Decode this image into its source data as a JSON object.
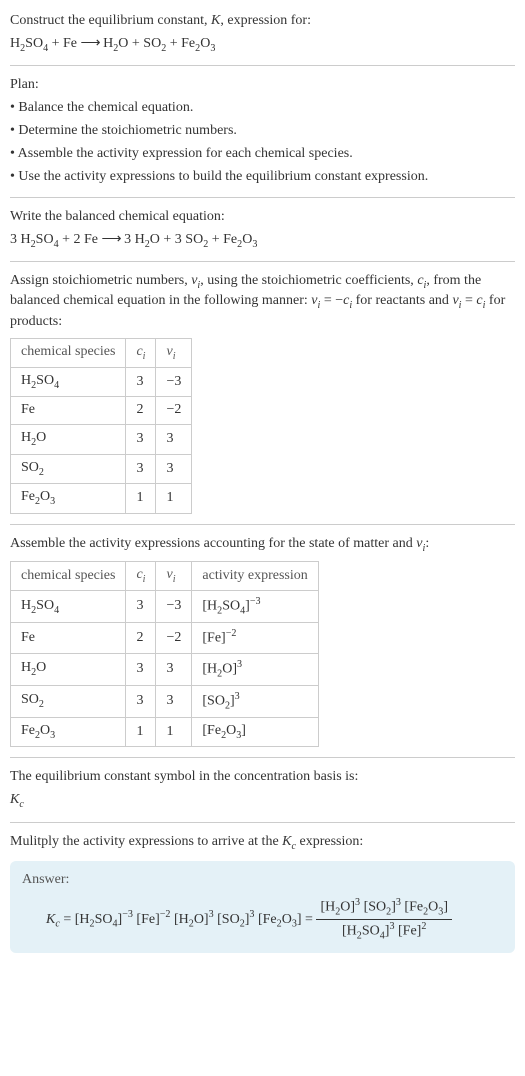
{
  "intro": {
    "line1_a": "Construct the equilibrium constant, ",
    "K": "K",
    "line1_b": ", expression for:",
    "eq_lhs1": "H",
    "eq_lhs2": "2",
    "eq_lhs3": "SO",
    "eq_lhs4": "4",
    "plus1": " + Fe ",
    "arrow": "⟶",
    "eq_rhs1": " H",
    "eq_rhs2": "2",
    "eq_rhs3": "O + SO",
    "eq_rhs4": "2",
    "eq_rhs5": " + Fe",
    "eq_rhs6": "2",
    "eq_rhs7": "O",
    "eq_rhs8": "3"
  },
  "plan": {
    "title": "Plan:",
    "b1": "• Balance the chemical equation.",
    "b2": "• Determine the stoichiometric numbers.",
    "b3": "• Assemble the activity expression for each chemical species.",
    "b4": "• Use the activity expressions to build the equilibrium constant expression."
  },
  "balanced": {
    "title": "Write the balanced chemical equation:",
    "c1": "3 H",
    "c2": "2",
    "c3": "SO",
    "c4": "4",
    "c5": " + 2 Fe ",
    "arrow": "⟶",
    "c6": " 3 H",
    "c7": "2",
    "c8": "O + 3 SO",
    "c9": "2",
    "c10": " + Fe",
    "c11": "2",
    "c12": "O",
    "c13": "3"
  },
  "assign": {
    "t1": "Assign stoichiometric numbers, ",
    "nu": "ν",
    "i": "i",
    "t2": ", using the stoichiometric coefficients, ",
    "c": "c",
    "t3": ", from the balanced chemical equation in the following manner: ",
    "eq1a": " = −",
    "eq1b": " for reactants and ",
    "eq2a": " = ",
    "eq2b": " for products:"
  },
  "table1": {
    "h1": "chemical species",
    "h2": "c",
    "h2s": "i",
    "h3": "ν",
    "h3s": "i",
    "r1": {
      "s1": "H",
      "s2": "2",
      "s3": "SO",
      "s4": "4",
      "c": "3",
      "v": "−3"
    },
    "r2": {
      "s1": "Fe",
      "c": "2",
      "v": "−2"
    },
    "r3": {
      "s1": "H",
      "s2": "2",
      "s3": "O",
      "c": "3",
      "v": "3"
    },
    "r4": {
      "s1": "SO",
      "s2": "2",
      "c": "3",
      "v": "3"
    },
    "r5": {
      "s1": "Fe",
      "s2": "2",
      "s3": "O",
      "s4": "3",
      "c": "1",
      "v": "1"
    }
  },
  "assemble": {
    "t1": "Assemble the activity expressions accounting for the state of matter and ",
    "nu": "ν",
    "i": "i",
    "t2": ":"
  },
  "table2": {
    "h1": "chemical species",
    "h2": "c",
    "h2s": "i",
    "h3": "ν",
    "h3s": "i",
    "h4": "activity expression",
    "r1": {
      "s1": "H",
      "s2": "2",
      "s3": "SO",
      "s4": "4",
      "c": "3",
      "v": "−3",
      "a1": "[H",
      "a2": "2",
      "a3": "SO",
      "a4": "4",
      "a5": "]",
      "exp": "−3"
    },
    "r2": {
      "s1": "Fe",
      "c": "2",
      "v": "−2",
      "a1": "[Fe]",
      "exp": "−2"
    },
    "r3": {
      "s1": "H",
      "s2": "2",
      "s3": "O",
      "c": "3",
      "v": "3",
      "a1": "[H",
      "a2": "2",
      "a3": "O]",
      "exp": "3"
    },
    "r4": {
      "s1": "SO",
      "s2": "2",
      "c": "3",
      "v": "3",
      "a1": "[SO",
      "a2": "2",
      "a3": "]",
      "exp": "3"
    },
    "r5": {
      "s1": "Fe",
      "s2": "2",
      "s3": "O",
      "s4": "3",
      "c": "1",
      "v": "1",
      "a1": "[Fe",
      "a2": "2",
      "a3": "O",
      "a4": "3",
      "a5": "]"
    }
  },
  "symbol": {
    "t1": "The equilibrium constant symbol in the concentration basis is:",
    "K": "K",
    "c": "c"
  },
  "multiply": {
    "t1": "Mulitply the activity expressions to arrive at the ",
    "K": "K",
    "c": "c",
    "t2": " expression:"
  },
  "answer": {
    "title": "Answer:",
    "K": "K",
    "c": "c",
    "eq": " = ",
    "p1a": "[H",
    "p1b": "2",
    "p1c": "SO",
    "p1d": "4",
    "p1e": "]",
    "p1exp": "−3",
    "p2a": " [Fe]",
    "p2exp": "−2",
    "p3a": " [H",
    "p3b": "2",
    "p3c": "O]",
    "p3exp": "3",
    "p4a": " [SO",
    "p4b": "2",
    "p4c": "]",
    "p4exp": "3",
    "p5a": " [Fe",
    "p5b": "2",
    "p5c": "O",
    "p5d": "3",
    "p5e": "]",
    "eq2": " = ",
    "n1a": "[H",
    "n1b": "2",
    "n1c": "O]",
    "n1exp": "3",
    "n2a": " [SO",
    "n2b": "2",
    "n2c": "]",
    "n2exp": "3",
    "n3a": " [Fe",
    "n3b": "2",
    "n3c": "O",
    "n3d": "3",
    "n3e": "]",
    "d1a": "[H",
    "d1b": "2",
    "d1c": "SO",
    "d1d": "4",
    "d1e": "]",
    "d1exp": "3",
    "d2a": " [Fe]",
    "d2exp": "2"
  }
}
